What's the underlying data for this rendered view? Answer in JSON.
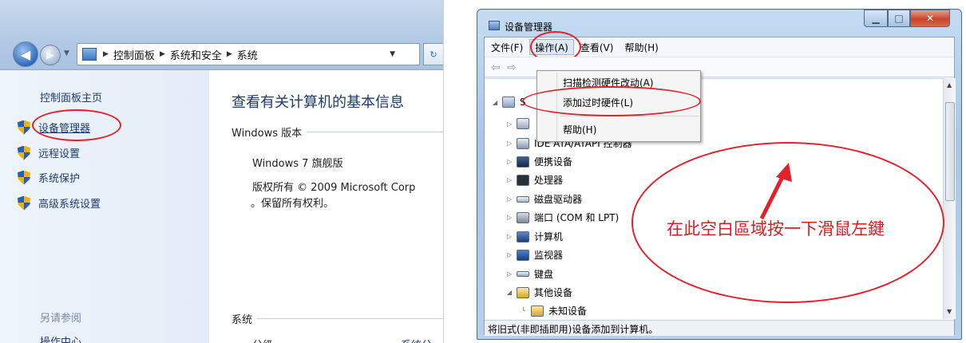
{
  "control_panel": {
    "breadcrumbs": [
      "控制面板",
      "系统和安全",
      "系统"
    ],
    "sidebar": {
      "home": "控制面板主页",
      "tasks": [
        {
          "label": "设备管理器"
        },
        {
          "label": "远程设置"
        },
        {
          "label": "系统保护"
        },
        {
          "label": "高级系统设置"
        }
      ],
      "see_also": "另请参阅",
      "action_center": "操作中心"
    },
    "main": {
      "title": "查看有关计算机的基本信息",
      "edition_header": "Windows 版本",
      "edition": "Windows 7 旗舰版",
      "copyright_line1": "版权所有 © 2009 Microsoft Corp",
      "copyright_line2": "。保留所有权利。",
      "system_header": "系统",
      "rating_label": "分级:",
      "rating_link": "系统分"
    }
  },
  "device_manager": {
    "title": "设备管理器",
    "menus": [
      "文件(F)",
      "操作(A)",
      "查看(V)",
      "帮助(H)"
    ],
    "action_menu": {
      "items": [
        "扫描检测硬件改动(A)",
        "添加过时硬件(L)",
        "帮助(H)"
      ]
    },
    "tree": {
      "root_partial": "S",
      "items": [
        {
          "label": "IDE ATA/ATAPI 控制器",
          "icon": "ide-controller-icon"
        },
        {
          "label": "便携设备",
          "icon": "portable-device-icon"
        },
        {
          "label": "处理器",
          "icon": "processor-icon"
        },
        {
          "label": "磁盘驱动器",
          "icon": "disk-drive-icon"
        },
        {
          "label": "端口 (COM 和 LPT)",
          "icon": "port-icon"
        },
        {
          "label": "计算机",
          "icon": "computer-icon"
        },
        {
          "label": "监视器",
          "icon": "monitor-icon"
        },
        {
          "label": "键盘",
          "icon": "keyboard-icon"
        },
        {
          "label": "其他设备",
          "icon": "other-devices-icon"
        },
        {
          "label": "未知设备",
          "icon": "unknown-device-icon"
        }
      ]
    },
    "status": "将旧式(非即插即用)设备添加到计算机。"
  },
  "annotation": {
    "text": "在此空白區域按一下滑鼠左鍵",
    "color": "#e2222b"
  }
}
